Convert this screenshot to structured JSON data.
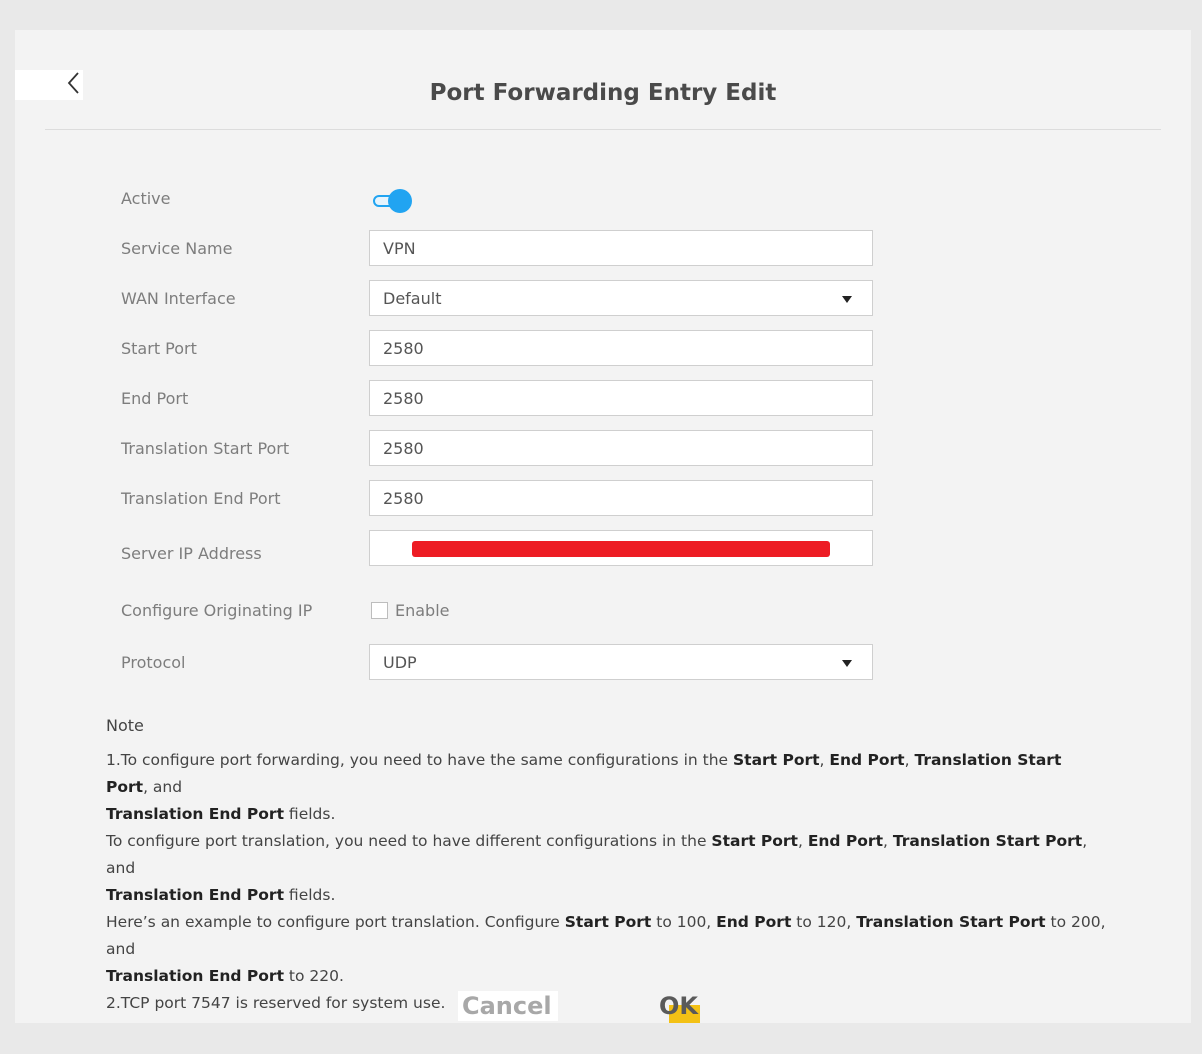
{
  "header": {
    "title": "Port Forwarding Entry Edit"
  },
  "form": {
    "active_label": "Active",
    "active_on": true,
    "service_name_label": "Service Name",
    "service_name_value": "VPN",
    "wan_interface_label": "WAN Interface",
    "wan_interface_value": "Default",
    "start_port_label": "Start Port",
    "start_port_value": "2580",
    "end_port_label": "End Port",
    "end_port_value": "2580",
    "translation_start_port_label": "Translation Start Port",
    "translation_start_port_value": "2580",
    "translation_end_port_label": "Translation End Port",
    "translation_end_port_value": "2580",
    "server_ip_label": "Server IP Address",
    "configure_originating_ip_label": "Configure Originating IP",
    "enable_label": "Enable",
    "protocol_label": "Protocol",
    "protocol_value": "UDP"
  },
  "note": {
    "title": "Note",
    "line1": {
      "a": "1.To configure port forwarding, you need to have the same configurations in the ",
      "start_port": "Start Port",
      "sep1": ", ",
      "end_port": "End Port",
      "sep2": ", ",
      "trans_start": "Translation Start Port",
      "and": ", and",
      "trans_end": "Translation End Port",
      "fields": " fields."
    },
    "line2": {
      "a": "To configure port translation, you need to have different configurations in the ",
      "start_port": "Start Port",
      "sep1": ", ",
      "end_port": "End Port",
      "sep2": ", ",
      "trans_start": "Translation Start Port",
      "and": ", and",
      "trans_end": "Translation End Port",
      "fields": " fields."
    },
    "line3": {
      "a": "Here’s an example to configure port translation. Configure ",
      "start_port": "Start Port",
      "b": " to 100, ",
      "end_port": "End Port",
      "c": " to 120, ",
      "trans_start": "Translation Start Port",
      "d": " to 200, and",
      "trans_end": "Translation End Port",
      "e": " to 220."
    },
    "line4": "2.TCP port 7547 is reserved for system use."
  },
  "buttons": {
    "cancel": "Cancel",
    "ok": "OK"
  },
  "colors": {
    "accent": "#21a4f1",
    "redaction": "#ed1c24",
    "ok_highlight": "#f3c115"
  },
  "icons": {
    "back": "chevron-left-icon",
    "dropdown": "caret-down-icon"
  }
}
